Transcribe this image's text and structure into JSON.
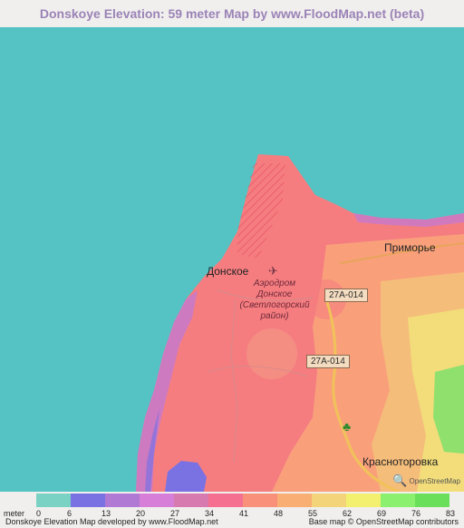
{
  "title": "Donskoye Elevation: 59 meter Map by www.FloodMap.net (beta)",
  "map": {
    "places": {
      "donskoye": "Донское",
      "primorye": "Приморье",
      "krasnotorovka": "Красноторовка",
      "airport_line1": "Аэродром",
      "airport_line2": "Донское",
      "airport_line3": "(Светлогорский",
      "airport_line4": "район)"
    },
    "roads": [
      "27A-014",
      "27A-014"
    ],
    "icons": [
      "airport-icon",
      "monument-icon",
      "search-icon"
    ],
    "attribution_logo": "OpenStreetMap"
  },
  "legend": {
    "unit": "meter",
    "ticks": [
      "0",
      "6",
      "13",
      "20",
      "27",
      "34",
      "41",
      "48",
      "55",
      "62",
      "69",
      "76",
      "83"
    ],
    "colors": [
      "#7ad2c4",
      "#7a72e2",
      "#b07ad4",
      "#d77ed8",
      "#d77ab0",
      "#f57090",
      "#f8907a",
      "#f9ae74",
      "#f4d47a",
      "#f2f06e",
      "#8af06e",
      "#6ae05a"
    ]
  },
  "footer": {
    "left": "Donskoye Elevation Map developed by www.FloodMap.net",
    "right": "Base map © OpenStreetMap contributors"
  }
}
